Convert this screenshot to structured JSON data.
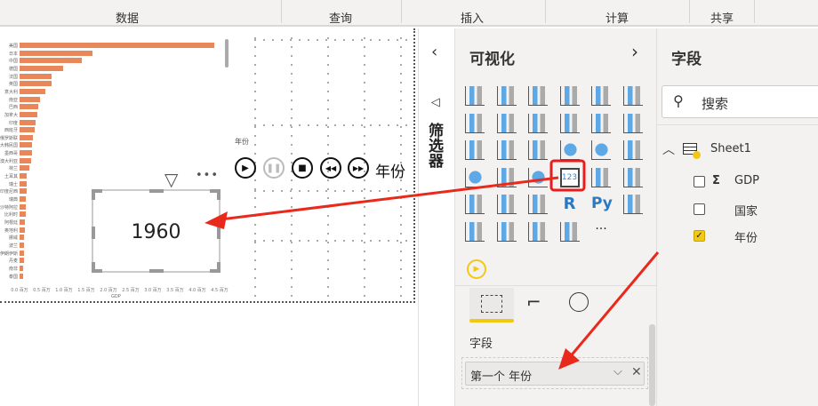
{
  "ribbon": {
    "groups": [
      "数据",
      "查询",
      "插入",
      "计算",
      "共享"
    ]
  },
  "chart_data": {
    "type": "bar",
    "orientation": "horizontal",
    "categories": [
      "美国",
      "日本",
      "中国",
      "德国",
      "法国",
      "英国",
      "意大利",
      "南亚",
      "巴西",
      "加拿大",
      "印度",
      "西班牙",
      "俄罗斯联邦",
      "大韩民国",
      "墨西哥",
      "澳大利亚",
      "荷兰",
      "土耳其",
      "瑞士",
      "印度尼西亚",
      "瑞典",
      "沙特阿拉伯",
      "比利时",
      "阿根廷",
      "奥地利",
      "挪威",
      "波兰",
      "伊朗伊斯兰共和国",
      "丹麦",
      "南非",
      "泰国"
    ],
    "values": [
      4.38,
      1.64,
      1.4,
      0.98,
      0.72,
      0.72,
      0.58,
      0.46,
      0.42,
      0.39,
      0.36,
      0.34,
      0.3,
      0.28,
      0.27,
      0.26,
      0.22,
      0.16,
      0.16,
      0.15,
      0.14,
      0.14,
      0.14,
      0.12,
      0.11,
      0.1,
      0.1,
      0.09,
      0.09,
      0.08,
      0.08
    ],
    "xticks": [
      "0.0 百万",
      "0.5 百万",
      "1.0 百万",
      "1.5 百万",
      "2.0 百万",
      "2.5 百万",
      "3.0 百万",
      "3.5 百万",
      "4.0 百万",
      "4.5 百万"
    ],
    "xlim": [
      0,
      4.5
    ],
    "xlabel": "GDP",
    "color": "#e8875a"
  },
  "card": {
    "value": "1960"
  },
  "play_axis": {
    "title": "年份",
    "field": "年份"
  },
  "filters": {
    "label": "筛选器"
  },
  "viz": {
    "title": "可视化",
    "card_icon_text": "123",
    "r_label": "R",
    "py_label": "Py",
    "more": "···",
    "fields_label": "字段",
    "well_value": "第一个 年份"
  },
  "fields": {
    "title": "字段",
    "search_placeholder": "搜索",
    "table": "Sheet1",
    "sigma": "Σ",
    "items": [
      {
        "label": "GDP",
        "checked": false
      },
      {
        "label": "国家",
        "checked": false
      },
      {
        "label": "年份",
        "checked": true
      }
    ]
  },
  "colors": {
    "accent": "#f2c811",
    "arrow": "#e8291c",
    "highlight": "#e81c1c"
  }
}
